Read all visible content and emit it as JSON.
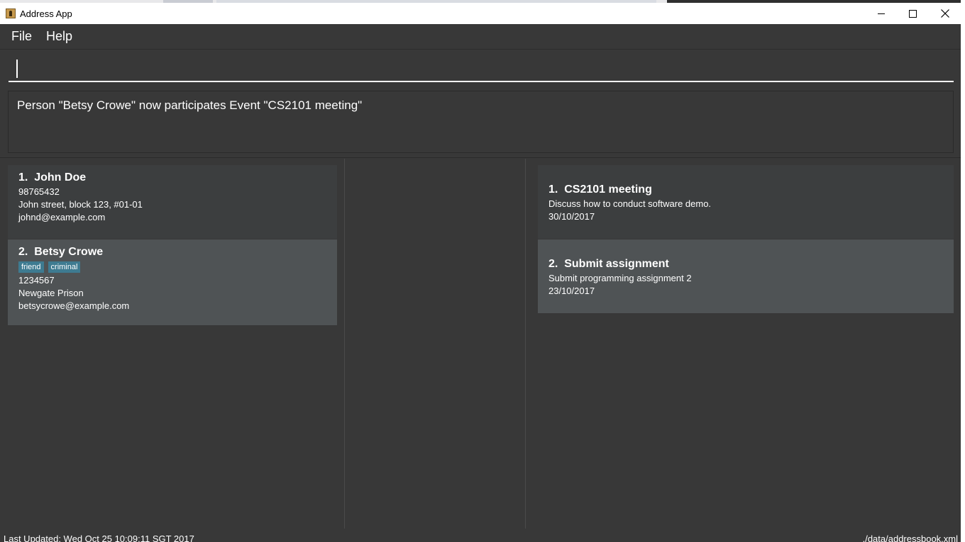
{
  "window": {
    "title": "Address App"
  },
  "menu": {
    "file": "File",
    "help": "Help"
  },
  "command": {
    "value": ""
  },
  "result": {
    "text": "Person \"Betsy Crowe\" now participates Event \"CS2101 meeting\""
  },
  "persons": [
    {
      "index": "1.",
      "name": "John Doe",
      "tags": [],
      "phone": "98765432",
      "address": "John street, block 123, #01-01",
      "email": "johnd@example.com"
    },
    {
      "index": "2.",
      "name": "Betsy Crowe",
      "tags": [
        "friend",
        "criminal"
      ],
      "phone": "1234567",
      "address": "Newgate Prison",
      "email": "betsycrowe@example.com"
    }
  ],
  "events": [
    {
      "index": "1.",
      "title": "CS2101 meeting",
      "description": "Discuss how to conduct software demo.",
      "date": "30/10/2017"
    },
    {
      "index": "2.",
      "title": "Submit assignment",
      "description": "Submit programming assignment 2",
      "date": "23/10/2017"
    }
  ],
  "status": {
    "last_updated": "Last Updated: Wed Oct 25 10:09:11 SGT 2017",
    "file_path": "./data/addressbook.xml"
  },
  "icons": {
    "app": "address-book-icon",
    "minimize": "minimize-icon",
    "maximize": "maximize-icon",
    "close": "close-icon"
  },
  "colors": {
    "background": "#383838",
    "card_odd": "#3c3e3f",
    "card_even": "#4f5355",
    "tag": "#3e7b91"
  }
}
